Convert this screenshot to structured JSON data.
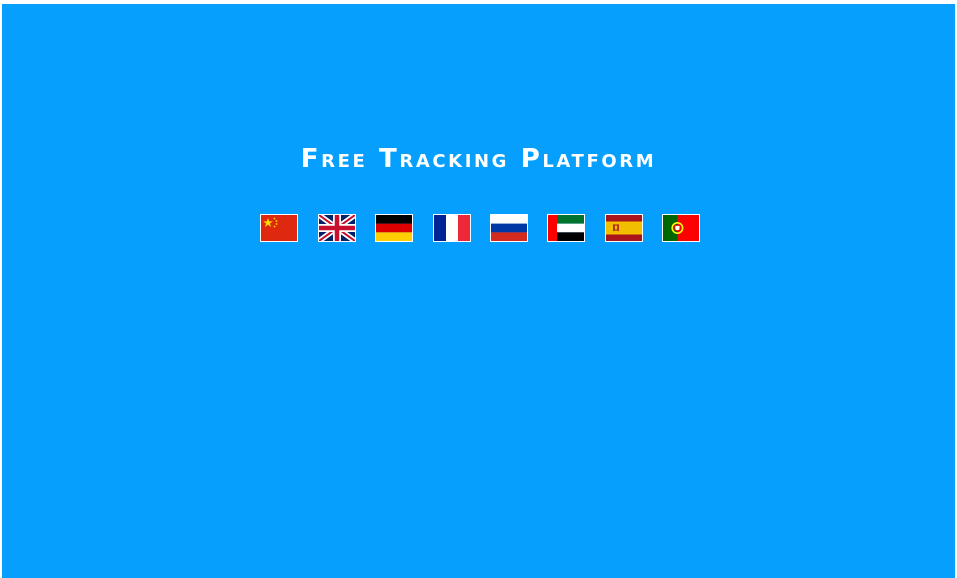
{
  "page": {
    "title": "Free Tracking Platform",
    "background_color": "#069ffe"
  },
  "languages": [
    {
      "code": "zh",
      "icon": "china-flag-icon"
    },
    {
      "code": "en",
      "icon": "uk-flag-icon"
    },
    {
      "code": "de",
      "icon": "germany-flag-icon"
    },
    {
      "code": "fr",
      "icon": "france-flag-icon"
    },
    {
      "code": "ru",
      "icon": "russia-flag-icon"
    },
    {
      "code": "ar",
      "icon": "uae-flag-icon"
    },
    {
      "code": "es",
      "icon": "spain-flag-icon"
    },
    {
      "code": "pt",
      "icon": "portugal-flag-icon"
    }
  ]
}
